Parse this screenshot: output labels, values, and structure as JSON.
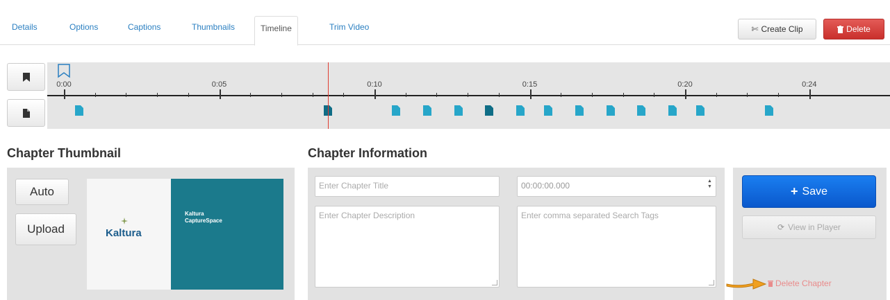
{
  "tabs": [
    {
      "label": "Details"
    },
    {
      "label": "Options"
    },
    {
      "label": "Captions"
    },
    {
      "label": "Thumbnails"
    },
    {
      "label": "Timeline",
      "active": true
    },
    {
      "label": "Trim Video"
    }
  ],
  "toolbar": {
    "create_clip_label": "Create Clip",
    "delete_label": "Delete"
  },
  "timeline": {
    "tick_labels": [
      "0:00",
      "0:05",
      "0:10",
      "0:15",
      "0:20",
      "0:24"
    ],
    "duration_seconds": 24,
    "playhead_seconds": 8.5,
    "chapter_marker_seconds": [
      0.5,
      8.5,
      10.7,
      11.7,
      12.7,
      13.7,
      14.7,
      15.6,
      16.6,
      17.6,
      18.6,
      19.6,
      20.5,
      22.7
    ],
    "selected_marker_seconds": [
      8.5,
      13.7
    ],
    "marker_color": "#27a6c9",
    "selected_marker_color": "#0f6d86",
    "playhead_color": "#e03c31"
  },
  "thumbnail": {
    "section_title": "Chapter Thumbnail",
    "auto_label": "Auto",
    "upload_label": "Upload",
    "image_logo": "Kaltura",
    "image_title_line1": "Kaltura",
    "image_title_line2": "CaptureSpace"
  },
  "info": {
    "section_title": "Chapter Information",
    "title_placeholder": "Enter Chapter Title",
    "time_value": "00:00:00.000",
    "description_placeholder": "Enter Chapter Description",
    "tags_placeholder": "Enter comma separated Search Tags"
  },
  "actions": {
    "save_label": "Save",
    "view_label": "View in Player",
    "delete_chapter_label": "Delete Chapter"
  },
  "colors": {
    "accent_blue": "#0a6ad9",
    "delete_red": "#d9534f",
    "teal": "#1b7a8c",
    "arrow_orange": "#f0a020"
  }
}
